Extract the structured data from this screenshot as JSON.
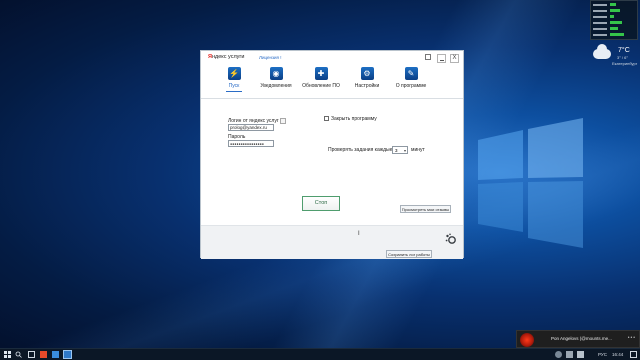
{
  "window": {
    "logo_brand": "Я",
    "logo_text": "ндекс услуги",
    "license_link": "Лицензия !",
    "close_glyph": "X"
  },
  "tabs": [
    {
      "label": "Пуск",
      "icon": "lightning-icon"
    },
    {
      "label": "Уведомления",
      "icon": "eye-icon"
    },
    {
      "label": "Обновление ПО",
      "icon": "puzzle-icon"
    },
    {
      "label": "Настройки",
      "icon": "settings-icon"
    },
    {
      "label": "О программе",
      "icon": "info-icon"
    }
  ],
  "form": {
    "login_label": "Логин от яндекс услуг",
    "login_value": "prolog@yandex.ru",
    "password_label": "Пароль",
    "password_value": "●●●●●●●●●●●●●●●●",
    "close_program_label": "Закрыть программу",
    "check_every_label": "Проверять задания каждые",
    "check_every_value": "3",
    "minutes_label": "минут"
  },
  "buttons": {
    "stop": "Стоп",
    "view_reviews": "Просмотреть мои отзывы",
    "save_log": "Сохранить лог работы"
  },
  "widgets": {
    "weather_temp": "7°C",
    "weather_sub": "3° / 6°",
    "weather_city": "Екатеринбург"
  },
  "taskbar": {
    "language": "РУС",
    "time": "16:44"
  },
  "notification": {
    "title": "Pon Angelovs (@mounts.me..."
  },
  "colors": {
    "accent": "#2a6cc6",
    "stop_button": "#4f9d6e",
    "desktop": "#0d4fa0"
  }
}
